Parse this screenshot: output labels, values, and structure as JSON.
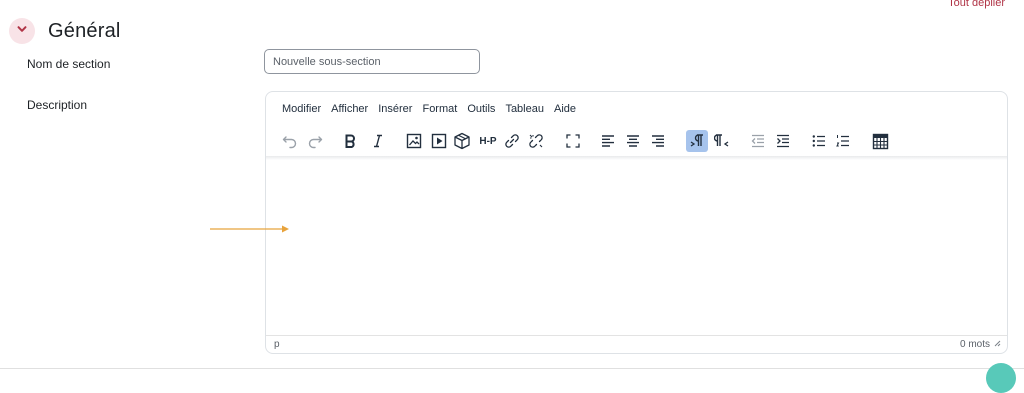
{
  "header": {
    "expand_all_label": "Tout déplier"
  },
  "section": {
    "title": "Général",
    "toggle_icon": "chevron-down-icon"
  },
  "fields": {
    "name_label": "Nom de section",
    "name_placeholder": "Nouvelle sous-section",
    "description_label": "Description"
  },
  "editor": {
    "menu": [
      "Modifier",
      "Afficher",
      "Insérer",
      "Format",
      "Outils",
      "Tableau",
      "Aide"
    ],
    "toolbar": {
      "h5p_label": "H-P",
      "icons": [
        "undo-icon",
        "redo-icon",
        "bold-icon",
        "italic-icon",
        "image-icon",
        "media-icon",
        "content-bank-icon",
        "h5p-icon",
        "link-icon",
        "unlink-icon",
        "fullscreen-icon",
        "align-left-icon",
        "align-center-icon",
        "align-right-icon",
        "ltr-icon",
        "rtl-icon",
        "outdent-icon",
        "indent-icon",
        "bullet-list-icon",
        "numbered-list-icon",
        "calculator-icon"
      ],
      "active_button": "ltr-icon"
    },
    "status_path": "p",
    "word_count": "0 mots"
  },
  "colors": {
    "accent": "#b03446",
    "chevron_bg": "#f8e3e7",
    "active_button_bg": "#a6c3ec",
    "annotation_arrow": "#e8a33c",
    "help_bubble": "#58c9b9"
  }
}
